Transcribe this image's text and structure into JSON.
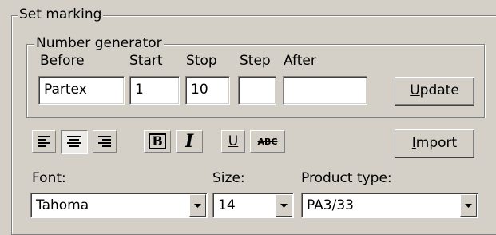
{
  "set_marking": {
    "legend": "Set marking"
  },
  "number_generator": {
    "legend": "Number generator",
    "labels": {
      "before": "Before",
      "start": "Start",
      "stop": "Stop",
      "step": "Step",
      "after": "After"
    },
    "values": {
      "before": "Partex",
      "start": "1",
      "stop": "10",
      "step": "",
      "after": ""
    },
    "update_button": {
      "accel": "U",
      "rest": "pdate"
    }
  },
  "toolbar": {
    "bold_glyph": "B",
    "italic_glyph": "I",
    "underline_glyph": "U",
    "strike_glyph": "ABC",
    "import_button": {
      "accel": "I",
      "rest": "mport"
    }
  },
  "font": {
    "label": "Font:",
    "value": "Tahoma"
  },
  "size": {
    "label": "Size:",
    "value": "14"
  },
  "product_type": {
    "label": "Product type:",
    "value": "PA3/33"
  },
  "icons": {
    "align_left": "align-left-icon",
    "align_center": "align-center-icon",
    "align_right": "align-right-icon",
    "bold": "bold-icon",
    "italic": "italic-icon",
    "underline": "underline-icon",
    "strikethrough": "strikethrough-icon",
    "dropdown": "chevron-down-icon"
  },
  "colors": {
    "dialog_face": "#d4d0c8",
    "field_background": "#ffffff",
    "frame_shadow": "#808080"
  }
}
